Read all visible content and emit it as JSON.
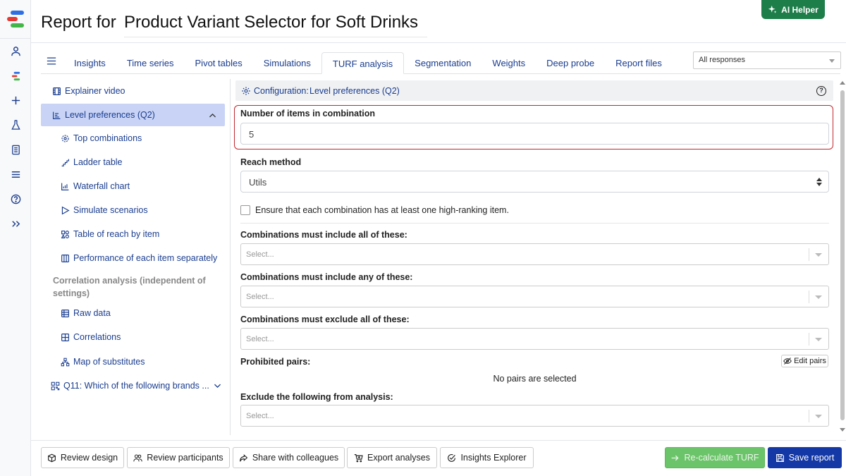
{
  "header": {
    "title_prefix": "Report for",
    "title": "Product Variant Selector for Soft Drinks",
    "ai_helper_label": "AI Helper"
  },
  "tabs": [
    {
      "label": "Insights"
    },
    {
      "label": "Time series"
    },
    {
      "label": "Pivot tables"
    },
    {
      "label": "Simulations"
    },
    {
      "label": "TURF analysis",
      "active": true
    },
    {
      "label": "Segmentation"
    },
    {
      "label": "Weights"
    },
    {
      "label": "Deep probe"
    },
    {
      "label": "Report files"
    }
  ],
  "response_filter": {
    "value": "All responses"
  },
  "sidebar": {
    "explainer_video": "Explainer video",
    "level_preferences": "Level preferences (Q2)",
    "sub_items": [
      {
        "label": "Top combinations",
        "icon": "cog-dots-icon"
      },
      {
        "label": "Ladder table",
        "icon": "ladder-icon"
      },
      {
        "label": "Waterfall chart",
        "icon": "waterfall-chart-icon"
      },
      {
        "label": "Simulate scenarios",
        "icon": "play-icon"
      },
      {
        "label": "Table of reach by item",
        "icon": "shapes-icon"
      },
      {
        "label": "Performance of each item separately",
        "icon": "columns-icon"
      }
    ],
    "correlation_group": "Correlation analysis (independent of settings)",
    "correlation_items": [
      {
        "label": "Raw data",
        "icon": "table-icon"
      },
      {
        "label": "Correlations",
        "icon": "grid-icon"
      },
      {
        "label": "Map of substitutes",
        "icon": "hierarchy-icon"
      }
    ],
    "q11_item": "Q11: Which of the following brands ..."
  },
  "config": {
    "header_label": "Configuration:",
    "header_value": "Level preferences (Q2)",
    "items_in_combination_label": "Number of items in combination",
    "items_in_combination_value": "5",
    "reach_method_label": "Reach method",
    "reach_method_value": "Utils",
    "high_ranking_checkbox_label": "Ensure that each combination has at least one high-ranking item.",
    "high_ranking_checked": false,
    "include_all_label": "Combinations must include all of these:",
    "include_all_placeholder": "Select...",
    "include_any_label": "Combinations must include any of these:",
    "include_any_placeholder": "Select...",
    "exclude_all_label": "Combinations must exclude all of these:",
    "exclude_all_placeholder": "Select...",
    "prohibited_pairs_label": "Prohibited pairs:",
    "edit_pairs_label": "Edit pairs",
    "no_pairs_text": "No pairs are selected",
    "exclude_analysis_label": "Exclude the following from analysis:",
    "exclude_analysis_placeholder": "Select..."
  },
  "footer": {
    "review_design": "Review design",
    "review_participants": "Review participants",
    "share": "Share with colleagues",
    "export": "Export analyses",
    "insights_explorer": "Insights Explorer",
    "recalculate": "Re-calculate TURF",
    "save": "Save report"
  },
  "colors": {
    "link_blue": "#1a3d8f",
    "ai_green": "#1e7e4a",
    "highlight_red": "#c0272d",
    "recalc_green": "#6cc46a",
    "save_blue": "#1438a6",
    "active_sidebar": "#c8d3f5"
  }
}
